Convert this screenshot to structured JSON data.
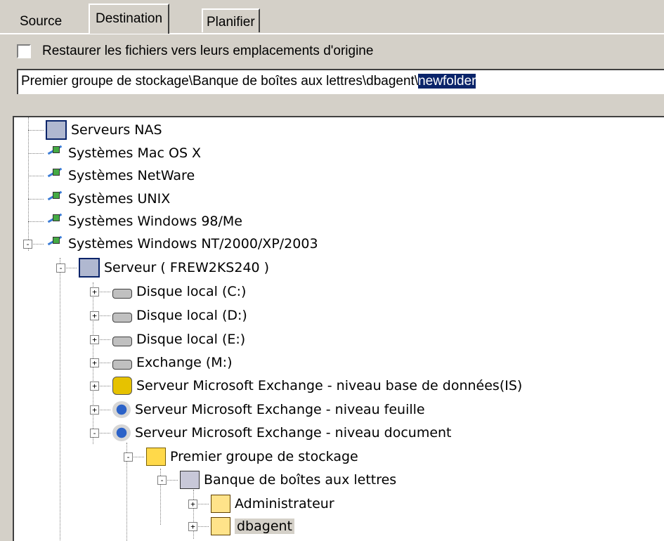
{
  "tabs": {
    "source": "Source",
    "destination": "Destination",
    "schedule": "Planifier"
  },
  "restore_option": {
    "label": "Restaurer les fichiers vers leurs emplacements d'origine",
    "checked": false
  },
  "path": {
    "prefix": "Premier groupe de stockage\\Banque de boîtes aux lettres\\dbagent\\",
    "selected": "newfolder"
  },
  "tree": [
    {
      "label": "Serveurs NAS",
      "icon": "nas-icon"
    },
    {
      "label": "Systèmes Mac OS X",
      "icon": "network-icon"
    },
    {
      "label": "Systèmes NetWare",
      "icon": "network-icon"
    },
    {
      "label": "Systèmes UNIX",
      "icon": "network-icon"
    },
    {
      "label": "Systèmes Windows 98/Me",
      "icon": "network-icon"
    },
    {
      "label": "Systèmes Windows NT/2000/XP/2003",
      "icon": "network-icon"
    },
    {
      "label": "Serveur ( FREW2KS240 )",
      "icon": "computer-icon"
    },
    {
      "label": "Disque local (C:)",
      "icon": "disk-icon"
    },
    {
      "label": "Disque local (D:)",
      "icon": "disk-icon"
    },
    {
      "label": "Disque local (E:)",
      "icon": "disk-icon"
    },
    {
      "label": "Exchange (M:)",
      "icon": "disk-icon"
    },
    {
      "label": "Serveur Microsoft Exchange - niveau base de données(IS)",
      "icon": "database-icon"
    },
    {
      "label": "Serveur Microsoft Exchange - niveau feuille",
      "icon": "exchange-icon"
    },
    {
      "label": "Serveur Microsoft Exchange - niveau document",
      "icon": "exchange-icon"
    },
    {
      "label": "Premier groupe de stockage",
      "icon": "storage-group-icon"
    },
    {
      "label": "Banque de boîtes aux lettres",
      "icon": "mailbox-store-icon"
    },
    {
      "label": "Administrateur",
      "icon": "mailbox-icon"
    },
    {
      "label": "dbagent",
      "icon": "mailbox-icon"
    }
  ],
  "colors": {
    "selection": "#0a246a",
    "window_bg": "#d4d0c8"
  }
}
